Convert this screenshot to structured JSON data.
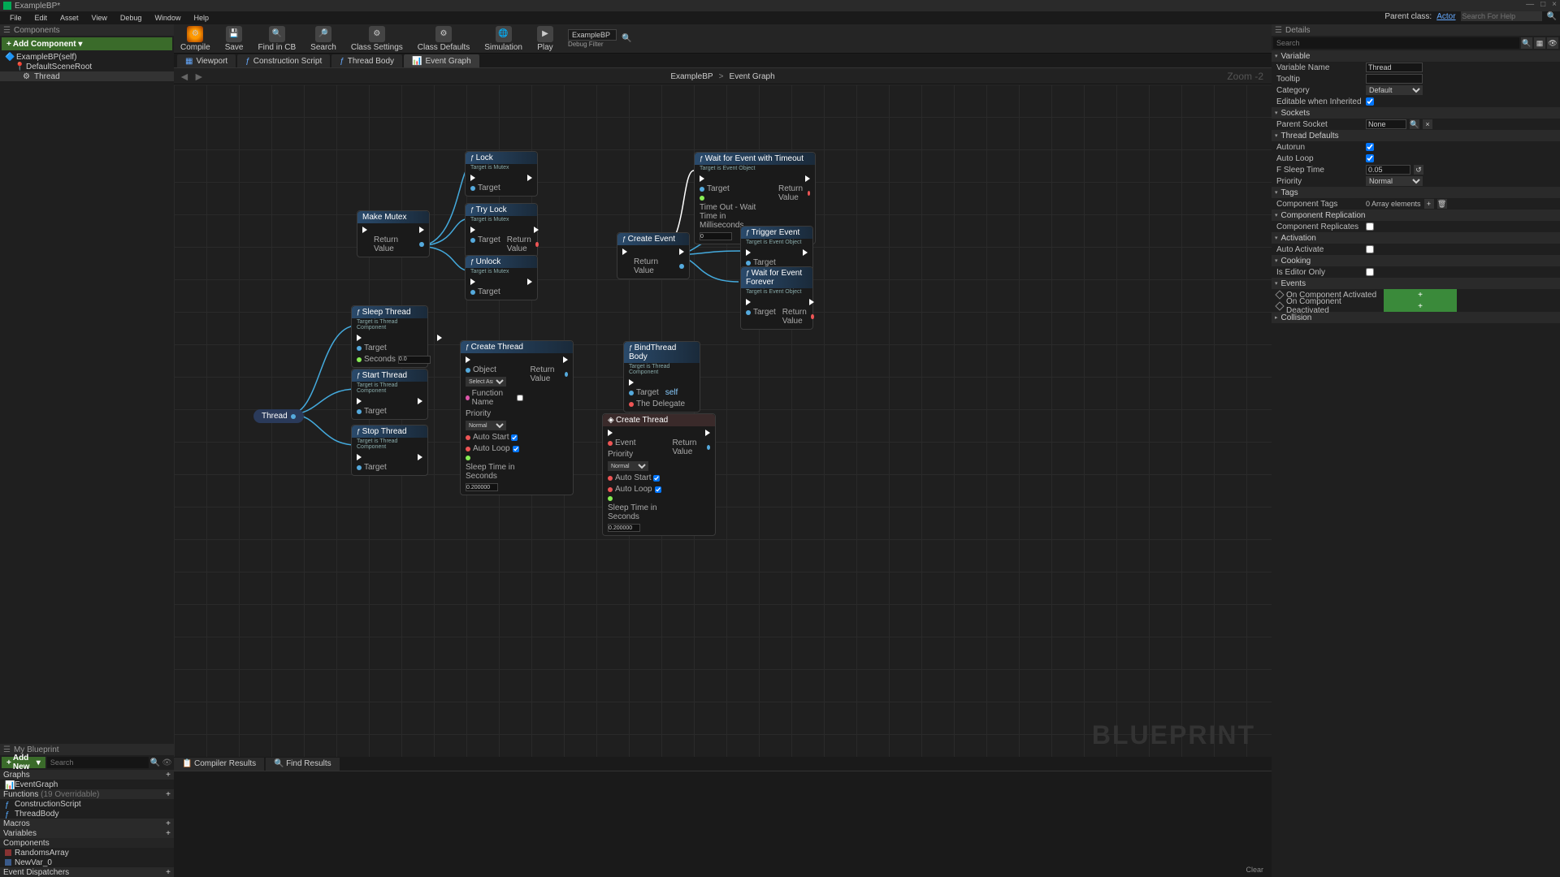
{
  "window": {
    "title": "ExampleBP*"
  },
  "winbuttons": [
    "—",
    "□",
    "×"
  ],
  "menubar": [
    "File",
    "Edit",
    "Asset",
    "View",
    "Debug",
    "Window",
    "Help"
  ],
  "parentclass": {
    "label": "Parent class:",
    "value": "Actor",
    "search_ph": "Search For Help"
  },
  "toolbar": {
    "compile": "Compile",
    "save": "Save",
    "findcb": "Find in CB",
    "search": "Search",
    "classsettings": "Class Settings",
    "classdefaults": "Class Defaults",
    "simulation": "Simulation",
    "play": "Play",
    "bpsearch": {
      "value": "ExampleBP",
      "debugfilter": "Debug Filter"
    }
  },
  "lefttop": {
    "panel": "Components",
    "addcomp": "Add Component",
    "root": "ExampleBP(self)",
    "dsr": "DefaultSceneRoot",
    "thread": "Thread"
  },
  "leftbot": {
    "panel": "My Blueprint",
    "addnew": "Add New",
    "search_ph": "Search",
    "graphs": "Graphs",
    "eventgraph": "EventGraph",
    "functions": "Functions",
    "funcover": "(19 Overridable)",
    "cs": "ConstructionScript",
    "tb": "ThreadBody",
    "macros": "Macros",
    "variables": "Variables",
    "components": "Components",
    "var1": "RandomsArray",
    "var2": "NewVar_0",
    "eventdis": "Event Dispatchers"
  },
  "tabs": {
    "viewport": "Viewport",
    "cs": "Construction Script",
    "tb": "Thread Body",
    "eg": "Event Graph"
  },
  "breadcrumb": {
    "root": "ExampleBP",
    "current": "Event Graph",
    "zoom": "Zoom -2"
  },
  "watermark": "BLUEPRINT",
  "results": {
    "compiler": "Compiler Results",
    "find": "Find Results",
    "clear": "Clear"
  },
  "nodes": {
    "makemutex": {
      "t": "Make Mutex",
      "rv": "Return Value"
    },
    "lock": {
      "t": "Lock",
      "s": "Target is Mutex",
      "target": "Target"
    },
    "trylock": {
      "t": "Try Lock",
      "s": "Target is Mutex",
      "target": "Target",
      "rv": "Return Value"
    },
    "unlock": {
      "t": "Unlock",
      "s": "Target is Mutex",
      "target": "Target"
    },
    "thread": "Thread",
    "sleep": {
      "t": "Sleep Thread",
      "s": "Target is Thread Component",
      "target": "Target",
      "sec": "Seconds",
      "secv": "0.0"
    },
    "start": {
      "t": "Start Thread",
      "s": "Target is Thread Component",
      "target": "Target"
    },
    "stop": {
      "t": "Stop Thread",
      "s": "Target is Thread Component",
      "target": "Target"
    },
    "createthread": {
      "t": "Create Thread",
      "obj": "Object",
      "objph": "Select Asset",
      "fn": "Function Name",
      "pri": "Priority",
      "priv": "Normal",
      "as": "Auto Start",
      "al": "Auto Loop",
      "st": "Sleep Time in Seconds",
      "stv": "0.200000",
      "rv": "Return Value"
    },
    "createthread2": {
      "t": "Create Thread",
      "ev": "Event",
      "pri": "Priority",
      "priv": "Normal",
      "as": "Auto Start",
      "al": "Auto Loop",
      "st": "Sleep Time in Seconds",
      "stv": "0.200000",
      "rv": "Return Value"
    },
    "bindbody": {
      "t": "BindThread Body",
      "s": "Target is Thread Component",
      "target": "Target",
      "self": "self",
      "del": "The Delegate"
    },
    "waittimeout": {
      "t": "Wait for Event with Timeout",
      "s": "Target is Event Object",
      "target": "Target",
      "to": "Time Out - Wait Time in Milliseconds",
      "tov": "0",
      "rv": "Return Value"
    },
    "createevent": {
      "t": "Create Event",
      "rv": "Return Value"
    },
    "trigger": {
      "t": "Trigger Event",
      "s": "Target is Event Object",
      "target": "Target"
    },
    "waitforever": {
      "t": "Wait for Event Forever",
      "s": "Target is Event Object",
      "target": "Target",
      "rv": "Return Value"
    }
  },
  "details": {
    "panel": "Details",
    "search_ph": "Search",
    "variable": {
      "hdr": "Variable",
      "name": "Variable Name",
      "namev": "Thread",
      "tooltip": "Tooltip",
      "cat": "Category",
      "catv": "Default",
      "ewi": "Editable when Inherited"
    },
    "sockets": {
      "hdr": "Sockets",
      "ps": "Parent Socket",
      "none": "None"
    },
    "threaddef": {
      "hdr": "Thread Defaults",
      "ar": "Autorun",
      "al": "Auto Loop",
      "fst": "F Sleep Time",
      "fstv": "0.05",
      "pri": "Priority",
      "priv": "Normal"
    },
    "tags": {
      "hdr": "Tags",
      "ct": "Component Tags",
      "arr": "0 Array elements"
    },
    "comprep": {
      "hdr": "Component Replication",
      "cr": "Component Replicates"
    },
    "activation": {
      "hdr": "Activation",
      "aa": "Auto Activate"
    },
    "cooking": {
      "hdr": "Cooking",
      "eo": "Is Editor Only"
    },
    "events": {
      "hdr": "Events",
      "oca": "On Component Activated",
      "ocd": "On Component Deactivated",
      "plus": "+"
    },
    "collision": {
      "hdr": "Collision"
    }
  }
}
